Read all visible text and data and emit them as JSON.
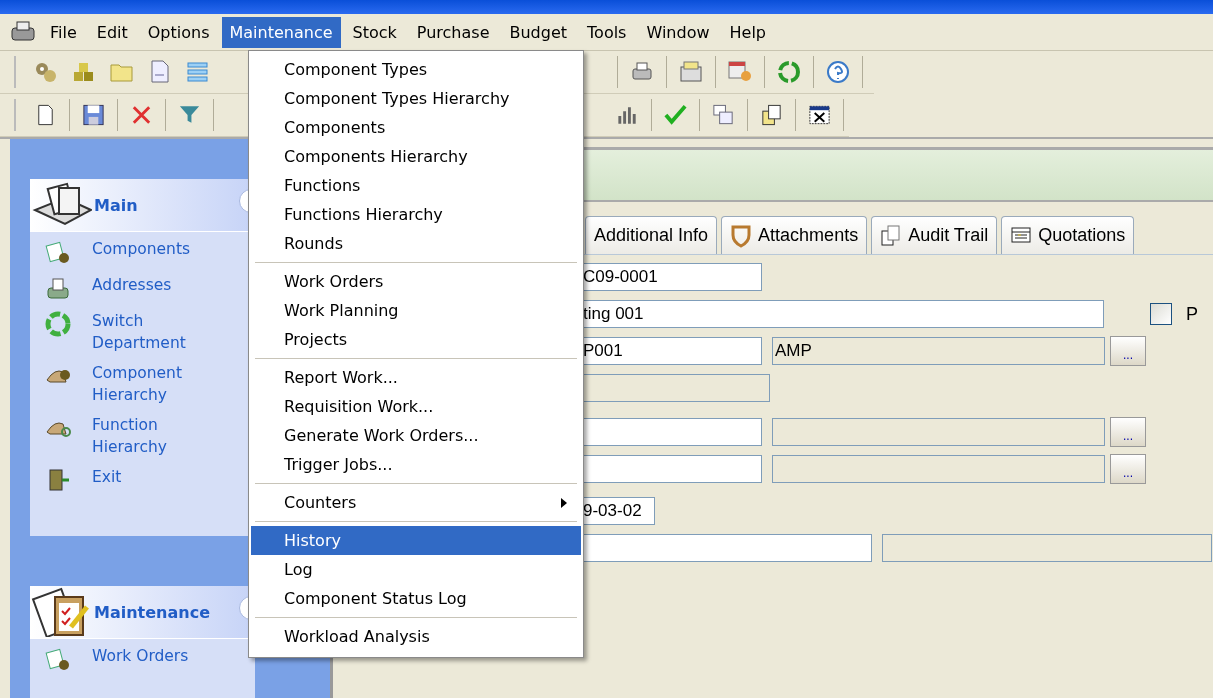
{
  "menubar": {
    "items": [
      {
        "label": "File",
        "selected": false
      },
      {
        "label": "Edit",
        "selected": false
      },
      {
        "label": "Options",
        "selected": false
      },
      {
        "label": "Maintenance",
        "selected": true
      },
      {
        "label": "Stock",
        "selected": false
      },
      {
        "label": "Purchase",
        "selected": false
      },
      {
        "label": "Budget",
        "selected": false
      },
      {
        "label": "Tools",
        "selected": false
      },
      {
        "label": "Window",
        "selected": false
      },
      {
        "label": "Help",
        "selected": false
      }
    ]
  },
  "dropdown": {
    "groups": [
      [
        {
          "label": "Component Types",
          "selected": false,
          "has_submenu": false
        },
        {
          "label": "Component Types Hierarchy",
          "selected": false,
          "has_submenu": false
        },
        {
          "label": "Components",
          "selected": false,
          "has_submenu": false
        },
        {
          "label": "Components Hierarchy",
          "selected": false,
          "has_submenu": false
        },
        {
          "label": "Functions",
          "selected": false,
          "has_submenu": false
        },
        {
          "label": "Functions Hierarchy",
          "selected": false,
          "has_submenu": false
        },
        {
          "label": "Rounds",
          "selected": false,
          "has_submenu": false
        }
      ],
      [
        {
          "label": "Work Orders",
          "selected": false,
          "has_submenu": false
        },
        {
          "label": "Work Planning",
          "selected": false,
          "has_submenu": false
        },
        {
          "label": "Projects",
          "selected": false,
          "has_submenu": false
        }
      ],
      [
        {
          "label": "Report Work...",
          "selected": false,
          "has_submenu": false
        },
        {
          "label": "Requisition Work...",
          "selected": false,
          "has_submenu": false
        },
        {
          "label": "Generate Work Orders...",
          "selected": false,
          "has_submenu": false
        },
        {
          "label": "Trigger Jobs...",
          "selected": false,
          "has_submenu": false
        }
      ],
      [
        {
          "label": "Counters",
          "selected": false,
          "has_submenu": true
        }
      ],
      [
        {
          "label": "History",
          "selected": true,
          "has_submenu": false
        },
        {
          "label": "Log",
          "selected": false,
          "has_submenu": false
        },
        {
          "label": "Component Status Log",
          "selected": false,
          "has_submenu": false
        }
      ],
      [
        {
          "label": "Workload Analysis",
          "selected": false,
          "has_submenu": false
        }
      ]
    ]
  },
  "sidebar": {
    "panels": [
      {
        "title": "Main",
        "items": [
          {
            "label": "Components"
          },
          {
            "label": "Addresses"
          },
          {
            "label": "Switch Department"
          },
          {
            "label": "Component Hierarchy"
          },
          {
            "label": "Function Hierarchy"
          },
          {
            "label": "Exit"
          }
        ]
      },
      {
        "title": "Maintenance",
        "items": [
          {
            "label": "Work Orders"
          }
        ]
      }
    ]
  },
  "tabs": [
    {
      "label": "Additional Info",
      "selected": false
    },
    {
      "label": "Attachments",
      "selected": false
    },
    {
      "label": "Audit Trail",
      "selected": false
    },
    {
      "label": "Quotations",
      "selected": false
    }
  ],
  "form": {
    "rows": [
      [
        {
          "kind": "input",
          "value": "C09-0001"
        }
      ],
      [
        {
          "kind": "wide_input",
          "value": "ting 001"
        },
        {
          "kind": "checkbox",
          "checked": false,
          "label": "P"
        }
      ],
      [
        {
          "kind": "input",
          "value": "P001"
        },
        {
          "kind": "readonly",
          "value": "AMP"
        },
        {
          "kind": "button",
          "value": "..."
        }
      ],
      [
        {
          "kind": "readonly_short"
        }
      ],
      [
        {
          "kind": "input"
        },
        {
          "kind": "readonly"
        },
        {
          "kind": "button",
          "value": "..."
        }
      ],
      [
        {
          "kind": "input"
        },
        {
          "kind": "readonly"
        },
        {
          "kind": "button",
          "value": "..."
        }
      ],
      [
        {
          "kind": "date",
          "value": "9-03-02"
        }
      ],
      [
        {
          "kind": "medium_input"
        },
        {
          "kind": "readonly_long"
        }
      ]
    ]
  }
}
